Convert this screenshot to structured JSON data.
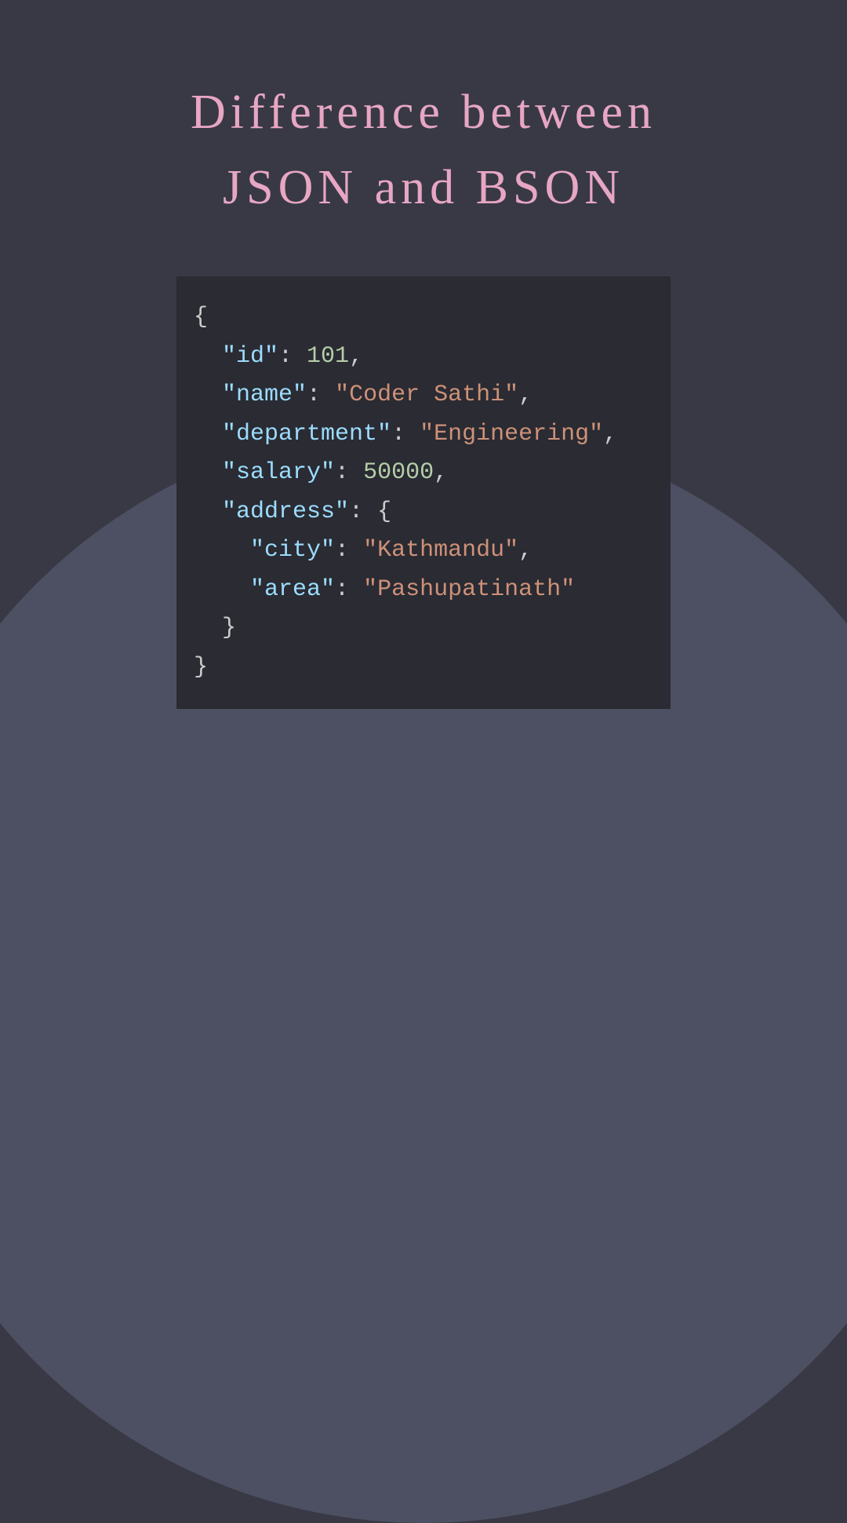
{
  "title_line1": "Difference between",
  "title_line2": "JSON and BSON",
  "code": {
    "open_brace": "{",
    "l1_key": "\"id\"",
    "l1_colon": ": ",
    "l1_val": "101",
    "l1_comma": ",",
    "l2_key": "\"name\"",
    "l2_colon": ": ",
    "l2_val": "\"Coder Sathi\"",
    "l2_comma": ",",
    "l3_key": "\"department\"",
    "l3_colon": ": ",
    "l3_val": "\"Engineering\"",
    "l3_comma": ",",
    "l4_key": "\"salary\"",
    "l4_colon": ": ",
    "l4_val": "50000",
    "l4_comma": ",",
    "l5_key": "\"address\"",
    "l5_colon": ": ",
    "l5_open": "{",
    "l6_key": "\"city\"",
    "l6_colon": ": ",
    "l6_val": "\"Kathmandu\"",
    "l6_comma": ",",
    "l7_key": "\"area\"",
    "l7_colon": ": ",
    "l7_val": "\"Pashupatinath\"",
    "l8_close": "}",
    "close_brace": "}",
    "indent1": "  ",
    "indent2": "    "
  }
}
